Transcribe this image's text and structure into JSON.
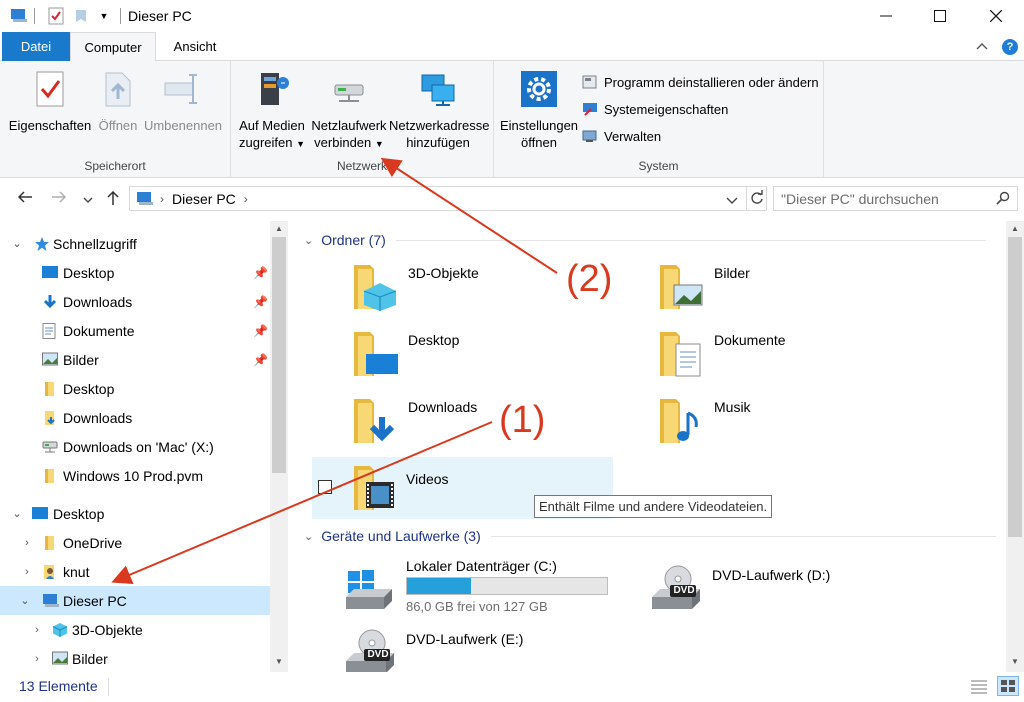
{
  "window": {
    "title": "Dieser PC",
    "minimize_icon": "minimize-icon",
    "maximize_icon": "maximize-icon",
    "close_icon": "close-icon"
  },
  "ribbon": {
    "tabs": [
      {
        "label": "Datei"
      },
      {
        "label": "Computer"
      },
      {
        "label": "Ansicht"
      }
    ],
    "groups": {
      "speicherort": {
        "label": "Speicherort",
        "buttons": [
          {
            "label": "Eigenschaften",
            "enabled": true
          },
          {
            "label": "Öffnen",
            "enabled": false
          },
          {
            "label": "Umbenennen",
            "enabled": false
          }
        ]
      },
      "netzwerk": {
        "label": "Netzwerk",
        "buttons": [
          {
            "line1": "Auf Medien",
            "line2": "zugreifen"
          },
          {
            "line1": "Netzlaufwerk",
            "line2": "verbinden"
          },
          {
            "line1": "Netzwerkadresse",
            "line2": "hinzufügen"
          }
        ]
      },
      "system": {
        "label": "System",
        "settings": {
          "line1": "Einstellungen",
          "line2": "öffnen"
        },
        "links": [
          {
            "label": "Programm deinstallieren oder ändern"
          },
          {
            "label": "Systemeigenschaften"
          },
          {
            "label": "Verwalten"
          }
        ]
      }
    }
  },
  "addressbar": {
    "path": "Dieser PC",
    "search_placeholder": "\"Dieser PC\" durchsuchen"
  },
  "navpane": {
    "items": [
      {
        "label": "Schnellzugriff",
        "icon": "star-icon"
      },
      {
        "label": "Desktop",
        "icon": "desktop-icon",
        "pinned": true
      },
      {
        "label": "Downloads",
        "icon": "download-icon",
        "pinned": true
      },
      {
        "label": "Dokumente",
        "icon": "document-icon",
        "pinned": true
      },
      {
        "label": "Bilder",
        "icon": "pictures-icon",
        "pinned": true
      },
      {
        "label": "Desktop",
        "icon": "folder-icon"
      },
      {
        "label": "Downloads",
        "icon": "folder-icon"
      },
      {
        "label": "Downloads on 'Mac' (X:)",
        "icon": "network-drive-icon"
      },
      {
        "label": "Windows 10 Prod.pvm",
        "icon": "folder-icon"
      },
      {
        "label": "Desktop",
        "icon": "desktop-icon"
      },
      {
        "label": "OneDrive",
        "icon": "folder-icon"
      },
      {
        "label": "knut",
        "icon": "user-icon"
      },
      {
        "label": "Dieser PC",
        "icon": "computer-icon",
        "selected": true
      },
      {
        "label": "3D-Objekte",
        "icon": "3d-objects-icon"
      },
      {
        "label": "Bilder",
        "icon": "pictures-icon"
      }
    ]
  },
  "content": {
    "folders_header": "Ordner (7)",
    "folders": [
      {
        "label": "3D-Objekte"
      },
      {
        "label": "Bilder"
      },
      {
        "label": "Desktop"
      },
      {
        "label": "Dokumente"
      },
      {
        "label": "Downloads"
      },
      {
        "label": "Musik"
      },
      {
        "label": "Videos"
      }
    ],
    "tooltip": "Enthält Filme und andere Videodateien.",
    "drives_header": "Geräte und Laufwerke (3)",
    "drives": [
      {
        "label": "Lokaler Datenträger (C:)",
        "free": "86,0 GB frei von 127 GB",
        "used_fraction": 0.32
      },
      {
        "label": "DVD-Laufwerk (D:)",
        "badge": "DVD"
      },
      {
        "label": "DVD-Laufwerk (E:)",
        "badge": "DVD"
      }
    ]
  },
  "status": {
    "count": "13 Elemente"
  },
  "annotations": {
    "one": "(1)",
    "two": "(2)",
    "color": "#d9391e"
  },
  "colors": {
    "accent": "#1979ca",
    "selection": "#cce8ff",
    "progress": "#26a0da",
    "folder": "#f8d775"
  }
}
